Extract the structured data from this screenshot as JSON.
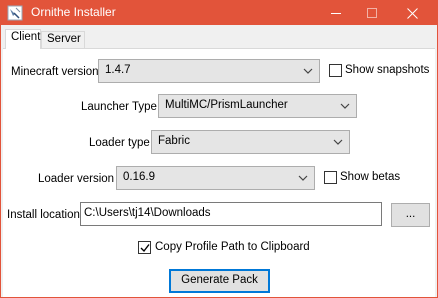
{
  "window": {
    "title": "Ornithe Installer"
  },
  "tabs": [
    {
      "label": "Client",
      "active": true
    },
    {
      "label": "Server",
      "active": false
    }
  ],
  "client": {
    "minecraft_version": {
      "label": "Minecraft version",
      "value": "1.4.7"
    },
    "show_snapshots": {
      "label": "Show snapshots",
      "checked": false
    },
    "launcher_type": {
      "label": "Launcher Type",
      "value": "MultiMC/PrismLauncher"
    },
    "loader_type": {
      "label": "Loader type",
      "value": "Fabric"
    },
    "loader_version": {
      "label": "Loader version",
      "value": "0.16.9"
    },
    "show_betas": {
      "label": "Show betas",
      "checked": false
    },
    "install_location": {
      "label": "Install location",
      "value": "C:\\Users\\tj14\\Downloads",
      "browse_label": "..."
    },
    "copy_profile_path": {
      "label": "Copy Profile Path to Clipboard",
      "checked": true
    },
    "generate_button": "Generate Pack"
  },
  "colors": {
    "titlebar": "#e2543a",
    "focus_border": "#0078d7"
  }
}
